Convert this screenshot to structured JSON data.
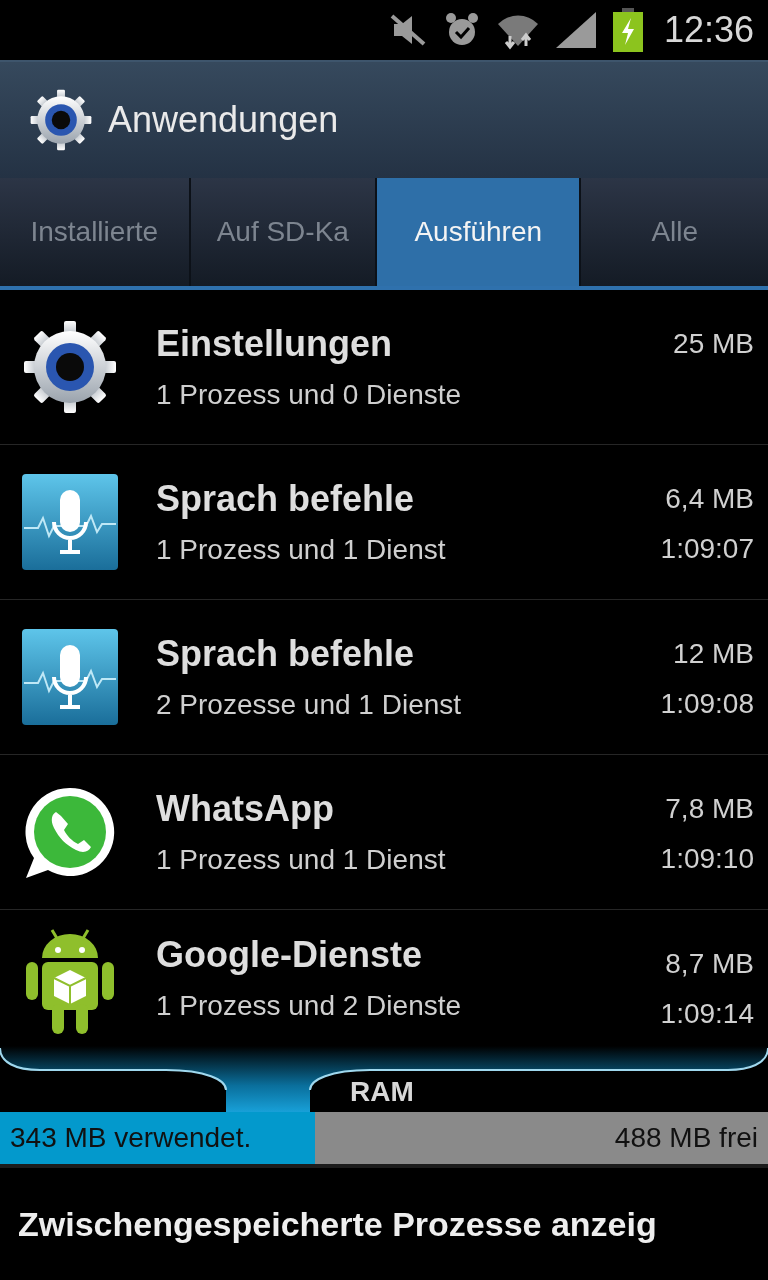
{
  "status_bar": {
    "time": "12:36"
  },
  "action_bar": {
    "title": "Anwendungen"
  },
  "tabs": [
    {
      "label": "Installierte",
      "selected": false
    },
    {
      "label": "Auf SD-Ka",
      "selected": false
    },
    {
      "label": "Ausführen",
      "selected": true
    },
    {
      "label": "Alle",
      "selected": false
    }
  ],
  "apps": [
    {
      "kind": "settings",
      "name": "Einstellungen",
      "detail": "1 Prozess und 0 Dienste",
      "size": "25 MB"
    },
    {
      "kind": "voice",
      "name": "Sprach befehle",
      "detail": "1 Prozess und 1 Dienst",
      "size": "6,4 MB",
      "time": "1:09:07"
    },
    {
      "kind": "voice",
      "name": "Sprach befehle",
      "detail": "2 Prozesse und 1 Dienst",
      "size": "12 MB",
      "time": "1:09:08"
    },
    {
      "kind": "chat",
      "name": "WhatsApp",
      "detail": "1 Prozess und 1 Dienst",
      "size": "7,8 MB",
      "time": "1:09:10"
    },
    {
      "kind": "android",
      "name": "Google-Dienste",
      "detail": "1 Prozess und 2 Dienste",
      "size": "8,7 MB",
      "time": "1:09:14"
    }
  ],
  "ram": {
    "label": "RAM",
    "level": 0.41,
    "used": "343 MB verwendet.",
    "free": "488 MB frei"
  },
  "footer_button": "Zwischengespeicherte Prozesse anzeig"
}
